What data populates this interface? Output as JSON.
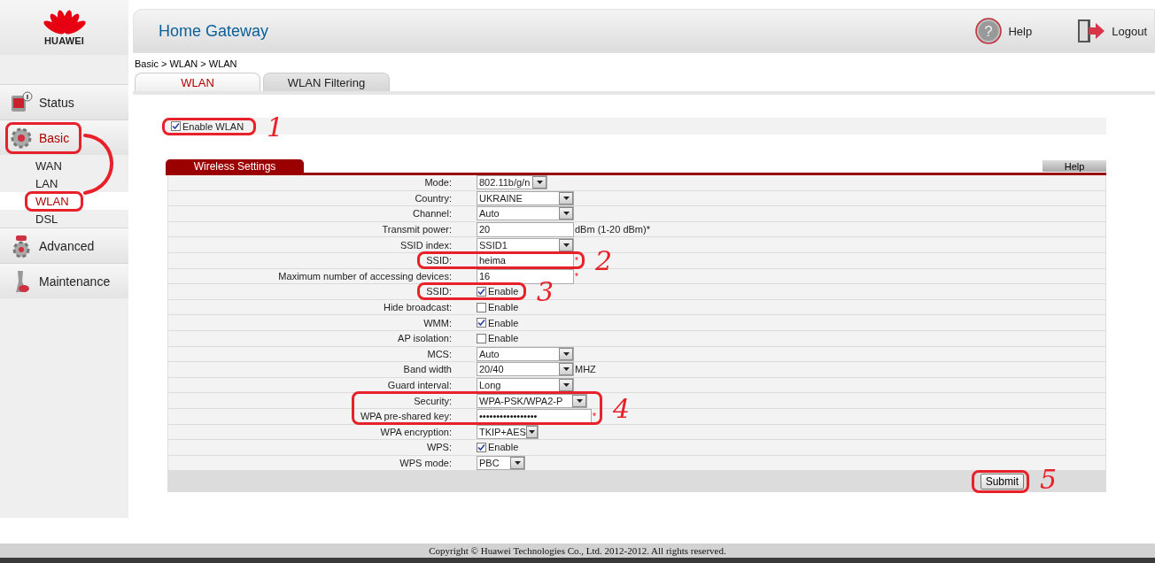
{
  "logo": "HUAWEI",
  "header": {
    "title": "Home Gateway",
    "help_glyph": "?",
    "help": "Help",
    "logout": "Logout"
  },
  "sidebar": {
    "items": [
      {
        "label": "Status",
        "selected": false,
        "circled": false
      },
      {
        "label": "Basic",
        "selected": true,
        "circled": true,
        "children": [
          {
            "label": "WAN",
            "selected": false,
            "circled": false
          },
          {
            "label": "LAN",
            "selected": false,
            "circled": false
          },
          {
            "label": "WLAN",
            "selected": true,
            "circled": true
          },
          {
            "label": "DSL",
            "selected": false,
            "circled": false
          }
        ]
      },
      {
        "label": "Advanced",
        "selected": false,
        "circled": false
      },
      {
        "label": "Maintenance",
        "selected": false,
        "circled": false
      }
    ]
  },
  "breadcrumb": "Basic > WLAN > WLAN",
  "tabs": [
    {
      "label": "WLAN",
      "selected": true
    },
    {
      "label": "WLAN Filtering",
      "selected": false
    }
  ],
  "enable_wlan": {
    "label": "Enable WLAN",
    "checked": true,
    "annotation": "1"
  },
  "section": {
    "title": "Wireless Settings",
    "help": "Help"
  },
  "rows": [
    {
      "kind": "select",
      "label": "Mode:",
      "value": "802.11b/g/n"
    },
    {
      "kind": "select",
      "label": "Country:",
      "value": "UKRAINE"
    },
    {
      "kind": "select",
      "label": "Channel:",
      "value": "Auto"
    },
    {
      "kind": "input",
      "label": "Transmit power:",
      "value": "20",
      "suffix": "dBm (1-20 dBm)*"
    },
    {
      "kind": "select",
      "label": "SSID index:",
      "value": "SSID1"
    },
    {
      "kind": "input",
      "label": "SSID:",
      "value": "heima",
      "required_mark": "*",
      "annotation": "2"
    },
    {
      "kind": "input",
      "label": "Maximum number of accessing devices:",
      "value": "16",
      "required_mark": "*"
    },
    {
      "kind": "checkbox",
      "label": "SSID:",
      "value": "Enable",
      "checked": true,
      "annotation": "3"
    },
    {
      "kind": "checkbox",
      "label": "Hide broadcast:",
      "value": "Enable",
      "checked": false
    },
    {
      "kind": "checkbox",
      "label": "WMM:",
      "value": "Enable",
      "checked": true
    },
    {
      "kind": "checkbox",
      "label": "AP isolation:",
      "value": "Enable",
      "checked": false
    },
    {
      "kind": "select",
      "label": "MCS:",
      "value": "Auto"
    },
    {
      "kind": "select",
      "label": "Band width",
      "value": "20/40",
      "suffix": "MHZ"
    },
    {
      "kind": "select",
      "label": "Guard interval:",
      "value": "Long"
    },
    {
      "kind": "group",
      "annotation": "4",
      "rows": [
        {
          "kind": "select",
          "label": "Security:",
          "value": "WPA-PSK/WPA2-P"
        },
        {
          "kind": "input",
          "label": "WPA pre-shared key:",
          "value": "•••••••••••••••••",
          "required_mark": "*"
        }
      ]
    },
    {
      "kind": "select",
      "label": "WPA encryption:",
      "value": "TKIP+AES"
    },
    {
      "kind": "checkbox",
      "label": "WPS:",
      "value": "Enable",
      "checked": true
    },
    {
      "kind": "select",
      "label": "WPS mode:",
      "value": "PBC"
    }
  ],
  "submit": {
    "label": "Submit",
    "annotation": "5"
  },
  "footer": "Copyright © Huawei Technologies Co., Ltd. 2012-2012. All rights reserved."
}
